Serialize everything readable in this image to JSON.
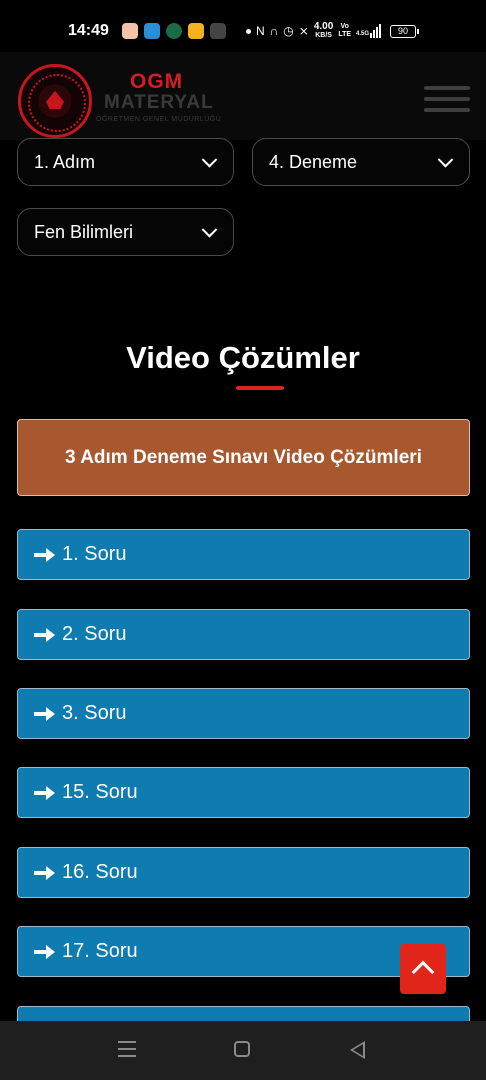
{
  "status_bar": {
    "time": "14:49",
    "speed_value": "4.00",
    "speed_unit": "KB/S",
    "volte_top": "Vo",
    "volte_bottom": "LTE",
    "network": "4.5G",
    "battery": "90",
    "app_icons": [
      "app-icon-orange",
      "app-icon-blue",
      "starbucks-icon",
      "app-icon-yellow",
      "app-icon-hadi"
    ],
    "app_icon_colors": [
      "#f2c3a6",
      "#2b8fd6",
      "#1b6b45",
      "#f5b21b",
      "#444444"
    ]
  },
  "header": {
    "logo_line1": "OGM",
    "logo_line2": "MATERYAL",
    "logo_line3": "ÖĞRETMEN GENEL MÜDÜRLÜĞÜ"
  },
  "filters": {
    "adim": "1. Adım",
    "deneme": "4. Deneme",
    "ders": "Fen Bilimleri"
  },
  "section": {
    "title": "Video Çözümler",
    "banner": "3 Adım Deneme Sınavı Video Çözümleri"
  },
  "questions": [
    "1. Soru",
    "2. Soru",
    "3. Soru",
    "15. Soru",
    "16. Soru",
    "17. Soru",
    ""
  ],
  "colors": {
    "accent_red": "#e1251b",
    "banner_brown": "#a8582f",
    "button_blue": "#0e7bb1"
  }
}
